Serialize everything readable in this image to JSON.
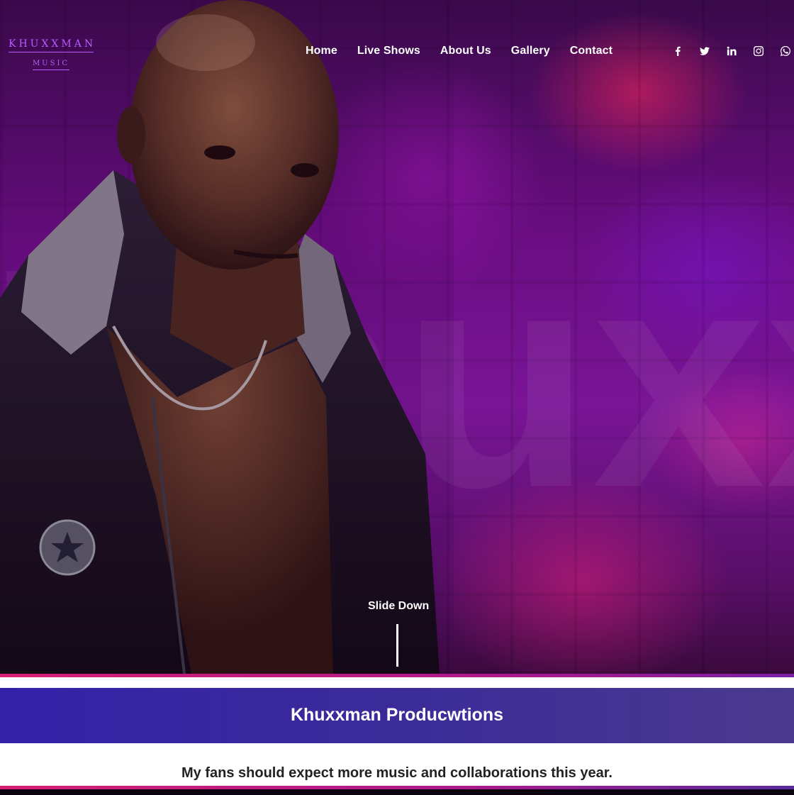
{
  "brand": {
    "name": "KHUXXMAN",
    "tagline": "MUSIC",
    "color": "#b85cff"
  },
  "nav": {
    "items": [
      {
        "label": "Home"
      },
      {
        "label": "Live Shows"
      },
      {
        "label": "About Us"
      },
      {
        "label": "Gallery"
      },
      {
        "label": "Contact"
      }
    ]
  },
  "social": {
    "icons": [
      "facebook-icon",
      "twitter-icon",
      "linkedin-icon",
      "instagram-icon",
      "whatsapp-icon"
    ]
  },
  "hero": {
    "watermark_text": "Khuxxman",
    "slide_down_label": "Slide Down"
  },
  "banner": {
    "title": "Khuxxman Producwtions"
  },
  "intro": {
    "text": "My fans should expect more music and collaborations this year."
  },
  "colors": {
    "accent_pink": "#d61f73",
    "band_blue": "#3322a8",
    "hero_purple": "#6a0d82"
  }
}
